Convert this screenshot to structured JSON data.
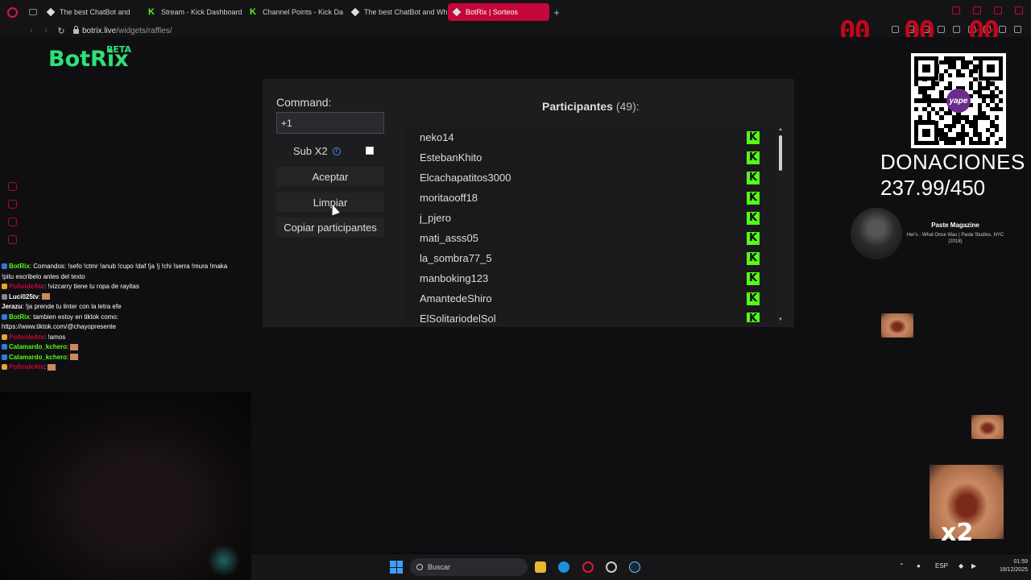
{
  "browser": {
    "tabs": [
      {
        "label": "The best ChatBot and",
        "icon": "diamond-icon"
      },
      {
        "label": "Stream - Kick Dashboard",
        "icon": "kick-icon"
      },
      {
        "label": "Channel Points - Kick Da",
        "icon": "kick-icon"
      },
      {
        "label": "The best ChatBot and Wh",
        "icon": "diamond-icon"
      },
      {
        "label": "BotRix | Sorteos",
        "icon": "diamond-icon",
        "active": true
      }
    ],
    "url_host": "botrix.live",
    "url_path": "/widgets/raffles/"
  },
  "overlay": {
    "red_digits_left": "00",
    "red_digits_mid": "00",
    "red_digits_right": "00"
  },
  "app": {
    "logo": "BotRix",
    "logo_badge": "BETA"
  },
  "raffle": {
    "command_label": "Command:",
    "command_value": "+1",
    "sub_label": "Sub X2",
    "sub_checked": false,
    "accept_label": "Aceptar",
    "clear_label": "Limpiar",
    "copy_label": "Copiar participantes",
    "participants_title": "Participantes",
    "participants_count": "(49):",
    "participants": [
      "neko14",
      "EstebanKhito",
      "Elcachapatitos3000",
      "moritaooff18",
      "j_pjero",
      "mati_asss05",
      "la_sombra77_5",
      "manboking123",
      "AmantedeShiro",
      "ElSolitariodelSol"
    ]
  },
  "stream": {
    "donations_label": "DONACIONES",
    "donations_value": "237.99/450",
    "qr_badge": "yape",
    "now_playing_title": "Paste Magazine",
    "now_playing_subtitle": "Her's - What Once Was | Paste Studios, NYC (2018)",
    "x2_label": "x2"
  },
  "chat": [
    {
      "name": "BotRix",
      "color": "#53fc18",
      "text": ": Comandos: !sefo !ctmr !anub !cupo !daf !ja !j !chi !serra !mura !maka"
    },
    {
      "name": "",
      "color": "#ffffff",
      "text": "!pitu escribelo antes del texto"
    },
    {
      "name": "PolloideAte",
      "color": "#c4063a",
      "text": ": !vizcarry tiene tu ropa de rayitas"
    },
    {
      "name": "Luci025tv",
      "color": "#ffffff",
      "text": ":"
    },
    {
      "name": "Jerazu",
      "color": "#ffffff",
      "text": ": !ja prende tu linter con la letra efe"
    },
    {
      "name": "BotRix",
      "color": "#53fc18",
      "text": ": tambien estoy en tiktok como:"
    },
    {
      "name": "",
      "color": "#ffffff",
      "text": "https://www.tiktok.com/@chayopresente"
    },
    {
      "name": "PolloideAte",
      "color": "#c4063a",
      "text": ": !amos"
    },
    {
      "name": "Calamardo_kchero",
      "color": "#53fc18",
      "text": ":"
    },
    {
      "name": "Calamardo_kchero",
      "color": "#53fc18",
      "text": ":"
    },
    {
      "name": "PolloideAte",
      "color": "#c4063a",
      "text": ":"
    }
  ],
  "taskbar": {
    "search_placeholder": "Buscar",
    "lang": "ESP",
    "time": "01:59",
    "date": "18/12/2025"
  }
}
